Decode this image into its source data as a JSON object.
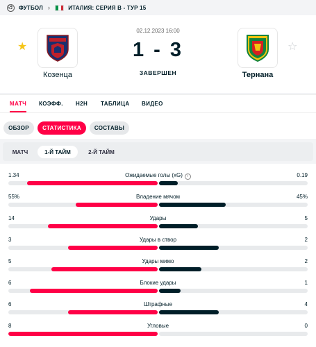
{
  "breadcrumb": {
    "sport": "ФУТБОЛ",
    "competition": "ИТАЛИЯ: СЕРИЯ B - ТУР 15",
    "flag_colors": [
      "#009246",
      "#ffffff",
      "#ce2b37"
    ]
  },
  "match": {
    "date": "02.12.2023 16:00",
    "score": "1 - 3",
    "status": "ЗАВЕРШЕН",
    "home": {
      "name": "Козенца",
      "favorite": true,
      "logo_colors": [
        "#1a2f6e",
        "#c0202a"
      ]
    },
    "away": {
      "name": "Тернана",
      "favorite": false,
      "logo_colors": [
        "#13843d",
        "#f1c40f",
        "#d62020"
      ]
    }
  },
  "main_tabs": [
    "МАТЧ",
    "КОЭФФ.",
    "H2H",
    "ТАБЛИЦА",
    "ВИДЕО"
  ],
  "sub_tabs": [
    "ОБЗОР",
    "СТАТИСТИКА",
    "СОСТАВЫ"
  ],
  "period_tabs": [
    "МАТЧ",
    "1-Й ТАЙМ",
    "2-Й ТАЙМ"
  ],
  "stats": [
    {
      "label": "Ожидаемые голы (xG)",
      "home": "1.34",
      "away": "0.19",
      "home_share": 0.876,
      "away_share": 0.124,
      "info": true
    },
    {
      "label": "Владение мячом",
      "home": "55%",
      "away": "45%",
      "home_share": 0.55,
      "away_share": 0.45
    },
    {
      "label": "Удары",
      "home": "14",
      "away": "5",
      "home_share": 0.737,
      "away_share": 0.263
    },
    {
      "label": "Удары в створ",
      "home": "3",
      "away": "2",
      "home_share": 0.6,
      "away_share": 0.4
    },
    {
      "label": "Удары мимо",
      "home": "5",
      "away": "2",
      "home_share": 0.714,
      "away_share": 0.286
    },
    {
      "label": "Блокие удары",
      "home": "6",
      "away": "1",
      "home_share": 0.857,
      "away_share": 0.143
    },
    {
      "label": "Штрафные",
      "home": "6",
      "away": "4",
      "home_share": 0.6,
      "away_share": 0.4
    },
    {
      "label": "Угловые",
      "home": "8",
      "away": "0",
      "home_share": 1.0,
      "away_share": 0.0
    }
  ],
  "colors": {
    "accent": "#ff0046",
    "dark": "#001e28",
    "track": "#e8eaec"
  }
}
